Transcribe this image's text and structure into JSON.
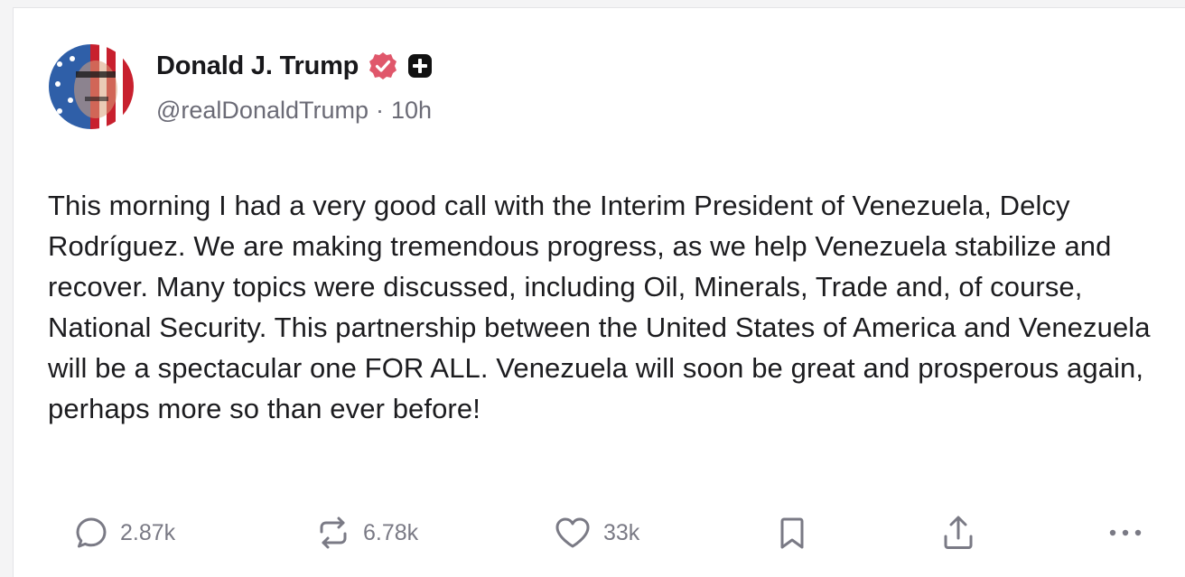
{
  "post": {
    "author_name": "Donald J. Trump",
    "handle": "@realDonaldTrump",
    "separator": "·",
    "time": "10h",
    "body": "This morning I had a very good call with the Interim President of Venezuela, Delcy Rodríguez. We are making tremendous progress, as we help Venezuela stabilize and recover. Many topics were discussed, including Oil, Minerals, Trade and, of course, National Security. This partnership between the United States of America and Venezuela will be a spectacular one FOR ALL. Venezuela will soon be great and prosperous again, perhaps more so than ever before!"
  },
  "actions": {
    "replies": "2.87k",
    "reposts": "6.78k",
    "likes": "33k"
  },
  "icons": {
    "verified": "verified-badge-icon",
    "plus": "plus-badge-icon",
    "reply": "reply-icon",
    "repost": "repost-icon",
    "like": "heart-icon",
    "bookmark": "bookmark-icon",
    "share": "share-icon",
    "more": "more-icon"
  },
  "colors": {
    "verified_badge": "#e0576b",
    "text": "#1c1c1f",
    "muted": "#7a7a85"
  }
}
